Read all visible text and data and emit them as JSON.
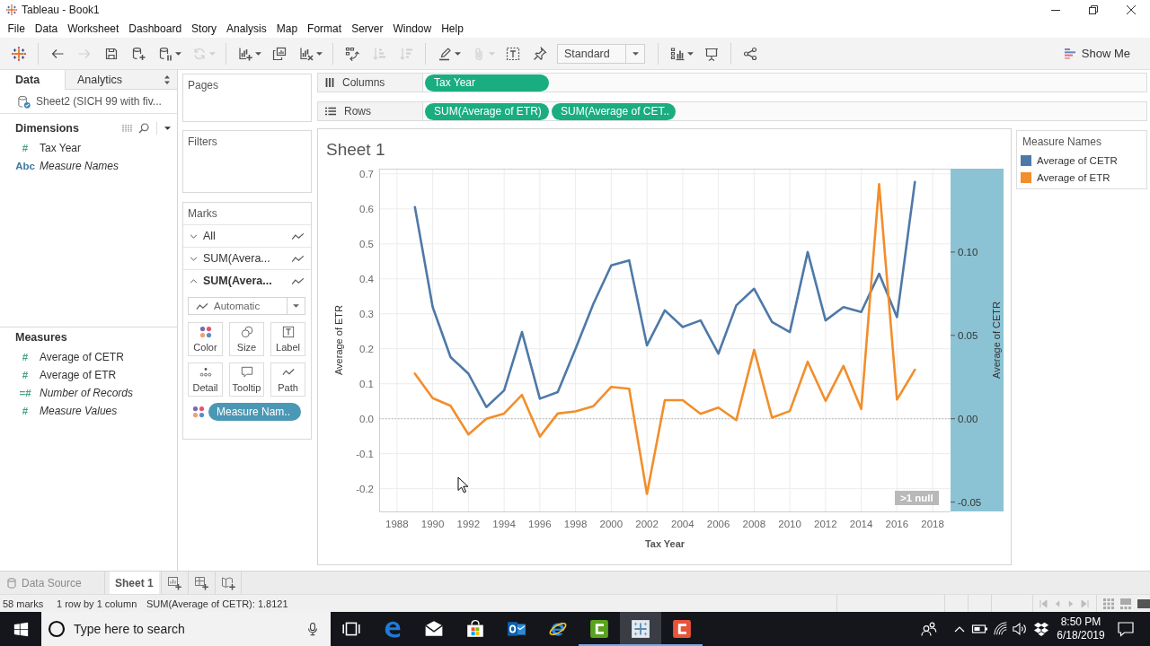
{
  "window": {
    "title": "Tableau - Book1"
  },
  "menu": [
    "File",
    "Data",
    "Worksheet",
    "Dashboard",
    "Story",
    "Analysis",
    "Map",
    "Format",
    "Server",
    "Window",
    "Help"
  ],
  "toolbar": {
    "groups": [
      [
        {
          "kind": "start",
          "disabled": false,
          "dropdown": false
        }
      ],
      [
        {
          "kind": "back",
          "disabled": false,
          "dropdown": false
        },
        {
          "kind": "forward",
          "disabled": true,
          "dropdown": false
        },
        {
          "kind": "save",
          "disabled": false,
          "dropdown": false
        },
        {
          "kind": "new-data-source",
          "disabled": false,
          "dropdown": false
        },
        {
          "kind": "pause-updates",
          "disabled": false,
          "dropdown": true
        },
        {
          "kind": "refresh",
          "disabled": true,
          "dropdown": true
        }
      ],
      [
        {
          "kind": "new-sheet",
          "disabled": false,
          "dropdown": true
        },
        {
          "kind": "duplicate",
          "disabled": false,
          "dropdown": false
        },
        {
          "kind": "clear",
          "disabled": false,
          "dropdown": true
        }
      ],
      [
        {
          "kind": "swap",
          "disabled": false,
          "dropdown": false
        },
        {
          "kind": "sort-ascending",
          "disabled": true,
          "dropdown": false
        },
        {
          "kind": "sort-descending",
          "disabled": true,
          "dropdown": false
        }
      ],
      [
        {
          "kind": "highlight",
          "disabled": false,
          "dropdown": true
        },
        {
          "kind": "group",
          "disabled": true,
          "dropdown": true
        },
        {
          "kind": "labels",
          "disabled": false,
          "dropdown": false
        },
        {
          "kind": "fix-axes",
          "disabled": false,
          "dropdown": false
        },
        {
          "kind": "fit",
          "disabled": false,
          "dropdown": true,
          "value": "Standard"
        }
      ],
      [
        {
          "kind": "show-cards",
          "disabled": false,
          "dropdown": true
        },
        {
          "kind": "presentation",
          "disabled": false,
          "dropdown": false
        }
      ],
      [
        {
          "kind": "share",
          "disabled": false,
          "dropdown": false
        }
      ]
    ],
    "show_me": "Show Me"
  },
  "data_pane": {
    "tabs": [
      {
        "label": "Data",
        "selected": true
      },
      {
        "label": "Analytics",
        "selected": false
      }
    ],
    "data_source": "Sheet2 (SICH 99 with fiv...",
    "dimensions": {
      "title": "Dimensions",
      "fields": [
        {
          "glyph": "#",
          "name": "Tax Year",
          "color": "#45a384",
          "generated": false
        },
        {
          "glyph": "Abc",
          "name": "Measure Names",
          "color": "#3f7aa0",
          "generated": true
        }
      ]
    },
    "measures": {
      "title": "Measures",
      "fields": [
        {
          "glyph": "#",
          "name": "Average of CETR",
          "color": "#45a384",
          "generated": false
        },
        {
          "glyph": "#",
          "name": "Average of ETR",
          "color": "#45a384",
          "generated": false
        },
        {
          "glyph": "=#",
          "name": "Number of Records",
          "color": "#45a384",
          "generated": true
        },
        {
          "glyph": "#",
          "name": "Measure Values",
          "color": "#45a384",
          "generated": true
        }
      ]
    }
  },
  "cards": {
    "pages": "Pages",
    "filters": "Filters",
    "marks": {
      "title": "Marks",
      "layers": [
        {
          "label": "All",
          "expanded": false
        },
        {
          "label": "SUM(Avera...",
          "expanded": false
        },
        {
          "label": "SUM(Avera...",
          "expanded": true
        }
      ],
      "mark_type": "Automatic",
      "properties": [
        {
          "kind": "color",
          "label": "Color"
        },
        {
          "kind": "size",
          "label": "Size"
        },
        {
          "kind": "label",
          "label": "Label"
        },
        {
          "kind": "detail",
          "label": "Detail"
        },
        {
          "kind": "tooltip",
          "label": "Tooltip"
        },
        {
          "kind": "path",
          "label": "Path"
        }
      ],
      "color_pill": "Measure Nam.."
    }
  },
  "shelves": {
    "columns": {
      "label": "Columns",
      "pills": [
        "Tax Year"
      ]
    },
    "rows": {
      "label": "Rows",
      "pills": [
        "SUM(Average of ETR)",
        "SUM(Average of CET.."
      ]
    }
  },
  "view": {
    "title": "Sheet 1",
    "right_axis_selected": true,
    "null_indicator": ">1 null",
    "chart_data": [
      {
        "type": "line",
        "xlabel": "Tax Year",
        "ylabel": "Average of ETR",
        "y2label": "Average of CETR",
        "x": [
          1989,
          1990,
          1991,
          1992,
          1993,
          1994,
          1995,
          1996,
          1997,
          1998,
          1999,
          2000,
          2001,
          2002,
          2003,
          2004,
          2005,
          2006,
          2007,
          2008,
          2009,
          2010,
          2011,
          2012,
          2013,
          2014,
          2015,
          2016,
          2017
        ],
        "xlim": [
          1987,
          2019
        ],
        "ylim": [
          -0.265,
          0.715
        ],
        "y2lim": [
          -0.0556,
          0.15
        ],
        "xticks": [
          1988,
          1990,
          1992,
          1994,
          1996,
          1998,
          2000,
          2002,
          2004,
          2006,
          2008,
          2010,
          2012,
          2014,
          2016,
          2018
        ],
        "yticks": [
          -0.2,
          -0.1,
          {
            "value": 0,
            "label": "0.0"
          },
          0.1,
          0.2,
          0.3,
          0.4,
          0.5,
          0.6,
          0.7
        ],
        "y2ticks": [
          -0.05,
          {
            "value": 0,
            "label": "0.00"
          },
          0.05,
          {
            "value": 0.1,
            "label": "0.10"
          }
        ],
        "grid": true,
        "ref_lines": [
          {
            "axis": "y",
            "value": 0,
            "line_style": "dotted"
          }
        ],
        "series": [
          {
            "color": "#4e79a7",
            "axis": "y2",
            "values": [
              0.127,
              0.067,
              0.037,
              0.027,
              0.007,
              0.017,
              0.052,
              0.012,
              0.016,
              0.042,
              0.069,
              0.092,
              0.095,
              0.044,
              0.065,
              0.055,
              0.059,
              0.039,
              0.068,
              0.078,
              0.058,
              0.052,
              0.1,
              0.059,
              0.067,
              0.064,
              0.087,
              0.061,
              0.142
            ]
          },
          {
            "color": "#f28e2b",
            "values": [
              0.129,
              0.059,
              0.037,
              -0.045,
              0,
              0.015,
              0.068,
              -0.051,
              0.015,
              0.021,
              0.036,
              0.091,
              0.086,
              -0.215,
              0.053,
              0.053,
              0.014,
              0.032,
              -0.004,
              0.197,
              0.003,
              0.022,
              0.163,
              0.051,
              0.151,
              0.028,
              0.671,
              0.055,
              0.14
            ]
          }
        ]
      }
    ]
  },
  "legend": {
    "title": "Measure Names",
    "items": [
      {
        "label": "Average of CETR",
        "color": "#4e79a7"
      },
      {
        "label": "Average of ETR",
        "color": "#f28e2b"
      }
    ]
  },
  "sheet_tabs": [
    {
      "label": "Data Source",
      "kind": "data-source",
      "selected": false
    },
    {
      "label": "Sheet 1",
      "kind": "sheet",
      "selected": true
    }
  ],
  "status_bar": [
    "58 marks",
    "1 row by 1 column",
    "SUM(Average of CETR): 1.8121"
  ],
  "taskbar": {
    "search": {
      "placeholder": "Type here to search"
    },
    "apps": [
      {
        "kind": "task-view",
        "running": false,
        "active": false
      },
      {
        "kind": "edge",
        "running": false,
        "active": false
      },
      {
        "kind": "mail",
        "running": false,
        "active": false
      },
      {
        "kind": "store",
        "running": false,
        "active": false
      },
      {
        "kind": "outlook",
        "running": false,
        "active": false
      },
      {
        "kind": "internet-explorer",
        "running": false,
        "active": false
      },
      {
        "kind": "camtasia-recorder",
        "running": true,
        "active": false
      },
      {
        "kind": "tableau",
        "running": true,
        "active": true
      },
      {
        "kind": "camtasia-editor",
        "running": true,
        "active": false
      }
    ],
    "time": "8:50 PM",
    "date": "6/18/2019"
  }
}
